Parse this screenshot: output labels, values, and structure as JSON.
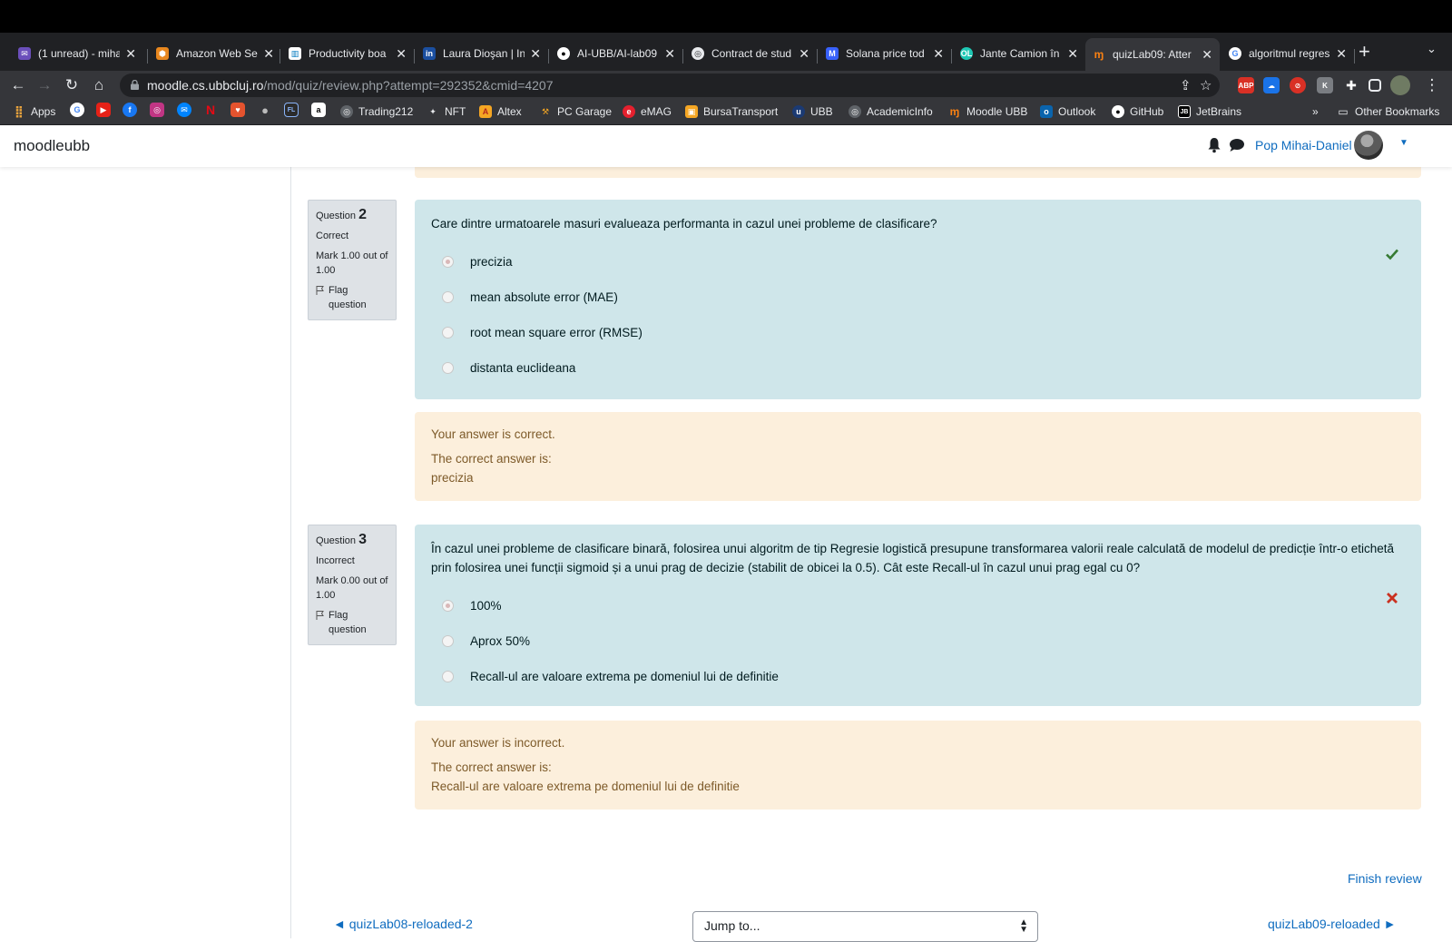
{
  "colors": {
    "accent": "#0f6cbf",
    "formulation_bg": "#cfe6ea",
    "outcome_bg": "#fcefdc",
    "correct": "#357a32",
    "incorrect": "#ca3120"
  },
  "tabs": [
    {
      "title": "(1 unread) - miha",
      "icon": "mail-icon",
      "color": "#6b4fbb"
    },
    {
      "title": "Amazon Web Ser",
      "icon": "aws-icon",
      "color": "#e8871e"
    },
    {
      "title": "Productivity boa",
      "icon": "trello-icon",
      "color": "#ffffff"
    },
    {
      "title": "Laura Dioşan | In",
      "icon": "linkedin-icon",
      "color": "#1b4fa0"
    },
    {
      "title": "AI-UBB/AI-lab09",
      "icon": "github-icon",
      "color": "#ffffff"
    },
    {
      "title": "Contract de stud",
      "icon": "globe-icon",
      "color": "#e8eaed"
    },
    {
      "title": "Solana price tod",
      "icon": "coinmarketcap-icon",
      "color": "#3861fb"
    },
    {
      "title": "Jante Camion în",
      "icon": "shop-icon",
      "color": "#1ec8b4"
    },
    {
      "title": "quizLab09: Atter",
      "icon": "moodle-icon",
      "color": "#f98012",
      "active": true
    },
    {
      "title": "algoritmul regres",
      "icon": "google-icon",
      "color": "#ffffff"
    }
  ],
  "url": {
    "host": "moodle.cs.ubbcluj.ro",
    "path": "/mod/quiz/review.php?attempt=292352&cmid=4207"
  },
  "bookmarks": [
    {
      "label": "Apps",
      "icon": "apps-grid-icon"
    },
    {
      "label": "Trading212",
      "icon": "globe-icon"
    },
    {
      "label": "NFT",
      "icon": "nft-icon"
    },
    {
      "label": "Altex",
      "icon": "altex-icon"
    },
    {
      "label": "PC Garage",
      "icon": "pcgarage-icon"
    },
    {
      "label": "eMAG",
      "icon": "emag-icon"
    },
    {
      "label": "BursaTransport",
      "icon": "bursa-icon"
    },
    {
      "label": "UBB",
      "icon": "ubb-icon"
    },
    {
      "label": "AcademicInfo",
      "icon": "globe-icon"
    },
    {
      "label": "Moodle UBB",
      "icon": "moodle-icon"
    },
    {
      "label": "Outlook",
      "icon": "outlook-icon"
    },
    {
      "label": "GitHub",
      "icon": "github-icon"
    },
    {
      "label": "JetBrains",
      "icon": "jetbrains-icon"
    }
  ],
  "bookmarks_overflow": "»",
  "other_bookmarks": "Other Bookmarks",
  "navbar": {
    "brand": "moodleubb",
    "user": "Pop Mihai-Daniel"
  },
  "questions": [
    {
      "number_label": "Question",
      "number": "2",
      "state": "Correct",
      "grade": "Mark 1.00 out of 1.00",
      "flag": "Flag question",
      "text": "Care dintre urmatoarele masuri evalueaza performanta in cazul unei probleme de clasificare?",
      "options": [
        "precizia",
        "mean absolute error (MAE)",
        "root mean square error (RMSE)",
        "distanta euclideana"
      ],
      "selected": 0,
      "feedback": "Your answer is correct.",
      "right_label": "The correct answer is:",
      "right_answer": "precizia"
    },
    {
      "number_label": "Question",
      "number": "3",
      "state": "Incorrect",
      "grade": "Mark 0.00 out of 1.00",
      "flag": "Flag question",
      "text": "În cazul unei probleme de clasificare binară, folosirea unui algoritm de tip Regresie logistică presupune transformarea valorii reale calculată de modelul de predicție într-o etichetă prin folosirea unei funcții sigmoid și a unui prag de decizie (stabilit de obicei la 0.5). Cât este Recall-ul în cazul unui prag egal cu 0?",
      "options": [
        "100%",
        "Aprox 50%",
        "Recall-ul are valoare extrema pe domeniul lui de definitie"
      ],
      "selected": 0,
      "feedback": "Your answer is incorrect.",
      "right_label": "The correct answer is:",
      "right_answer": "Recall-ul are valoare extrema pe domeniul lui de definitie"
    }
  ],
  "footer": {
    "finish": "Finish review",
    "prev": "◄ quizLab08-reloaded-2",
    "next": "quizLab09-reloaded ►",
    "jump": "Jump to..."
  }
}
